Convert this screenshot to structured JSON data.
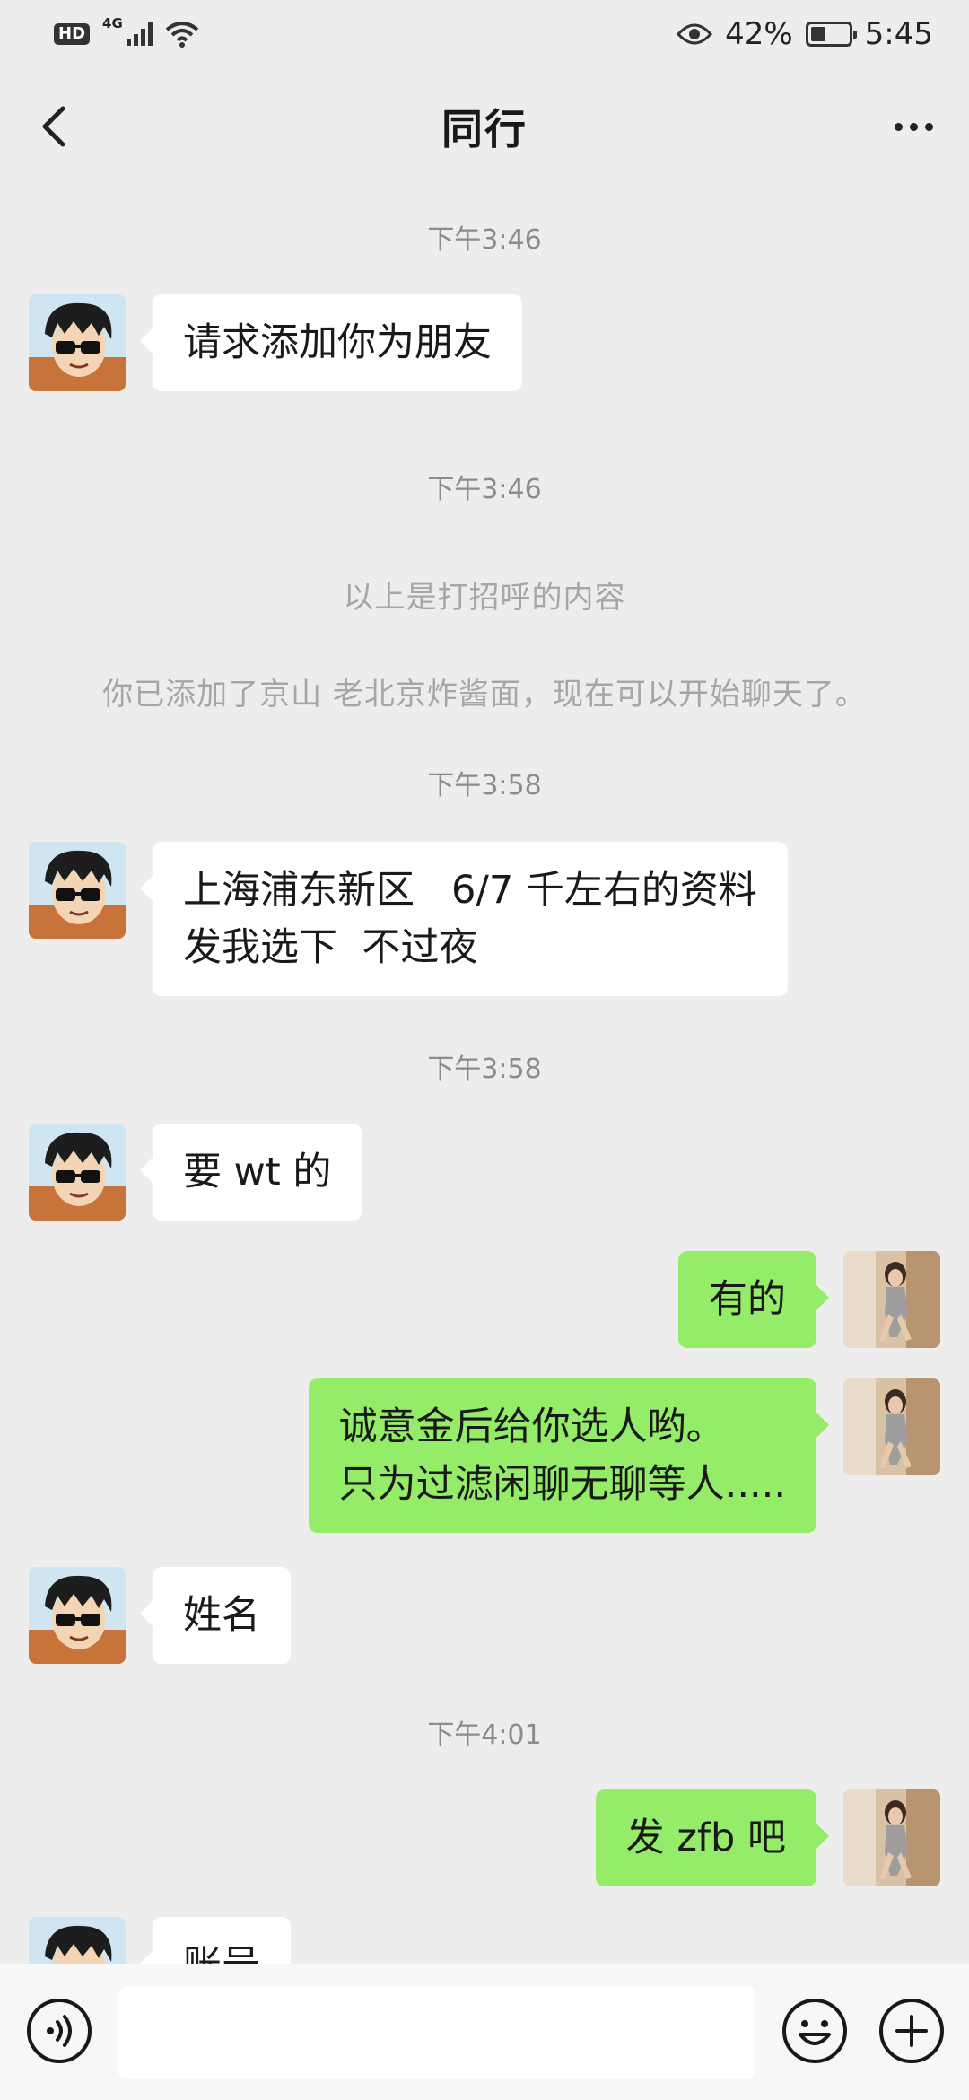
{
  "status": {
    "network_badge": "HD",
    "network_type": "4G",
    "battery": "42%",
    "battery_level": 0.42,
    "time": "5:45"
  },
  "header": {
    "title": "同行"
  },
  "colors": {
    "background": "#ededed",
    "incoming_bubble": "#ffffff",
    "outgoing_bubble": "#95ec69",
    "timestamp_text": "#8c8c8c",
    "system_text": "#a6a6a6"
  },
  "messages": {
    "ts1": "下午3:46",
    "m1": "请求添加你为朋友",
    "ts2": "下午3:46",
    "sys1": "以上是打招呼的内容",
    "sys2": "你已添加了京山 老北京炸酱面，现在可以开始聊天了。",
    "ts3": "下午3:58",
    "m2_line1": "上海浦东新区   6/7 千左右的资料",
    "m2_line2": "发我选下  不过夜",
    "ts4": "下午3:58",
    "m3": "要 wt 的",
    "m4": "有的",
    "m5_line1": "诚意金后给你选人哟。",
    "m5_line2": "只为过滤闲聊无聊等人.....",
    "m6": "姓名",
    "ts5": "下午4:01",
    "m7": "发 zfb 吧",
    "m8": "账号"
  },
  "icons": {
    "back": "chevron-left-icon",
    "more": "more-dots-icon",
    "voice": "voice-icon",
    "emoji": "emoji-icon",
    "plus": "plus-icon"
  }
}
